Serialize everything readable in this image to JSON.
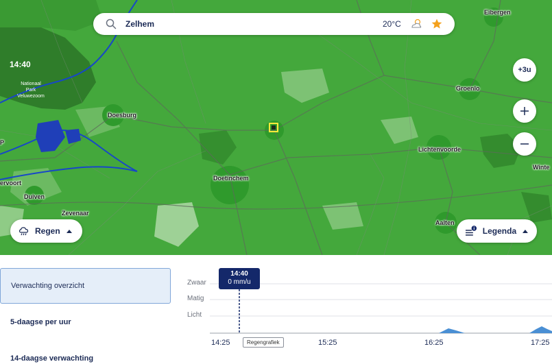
{
  "search": {
    "value": "Zelhem",
    "temperature": "20°C",
    "weather_icon": "partly-cloudy-icon",
    "favorite_icon": "star-icon"
  },
  "map": {
    "time": "14:40",
    "park": "Nationaal\nPark\nVeluwezoom",
    "cities": [
      "Eibergen",
      "Groenlo",
      "Doesburg",
      "Lichtenvoorde",
      "Doetinchem",
      "Duiven",
      "Zevenaar",
      "Aalten",
      "Winte",
      "ervoort",
      "P"
    ],
    "controls": {
      "time_step": "+3u",
      "zoom_in": "+",
      "zoom_out": "−"
    },
    "layer_button": "Regen",
    "legend_button": "Legenda"
  },
  "sidebar": {
    "items": [
      {
        "label": "Verwachting overzicht",
        "active": true
      },
      {
        "label": "5-daagse per uur",
        "active": false
      },
      {
        "label": "14-daagse verwachting",
        "active": false
      }
    ]
  },
  "rain_graph": {
    "now_time": "14:40",
    "now_value": "0 mm/u",
    "levels": [
      "Zwaar",
      "Matig",
      "Licht"
    ],
    "x_ticks": [
      "14:25",
      "15:25",
      "16:25",
      "17:25"
    ],
    "tag": "Regengrafiek"
  },
  "colors": {
    "accent_dark": "#14286a",
    "text": "#1b2a55",
    "map_green": "#3fa33b",
    "rain_fill": "#4a8fd4",
    "star": "#f4a11d"
  }
}
